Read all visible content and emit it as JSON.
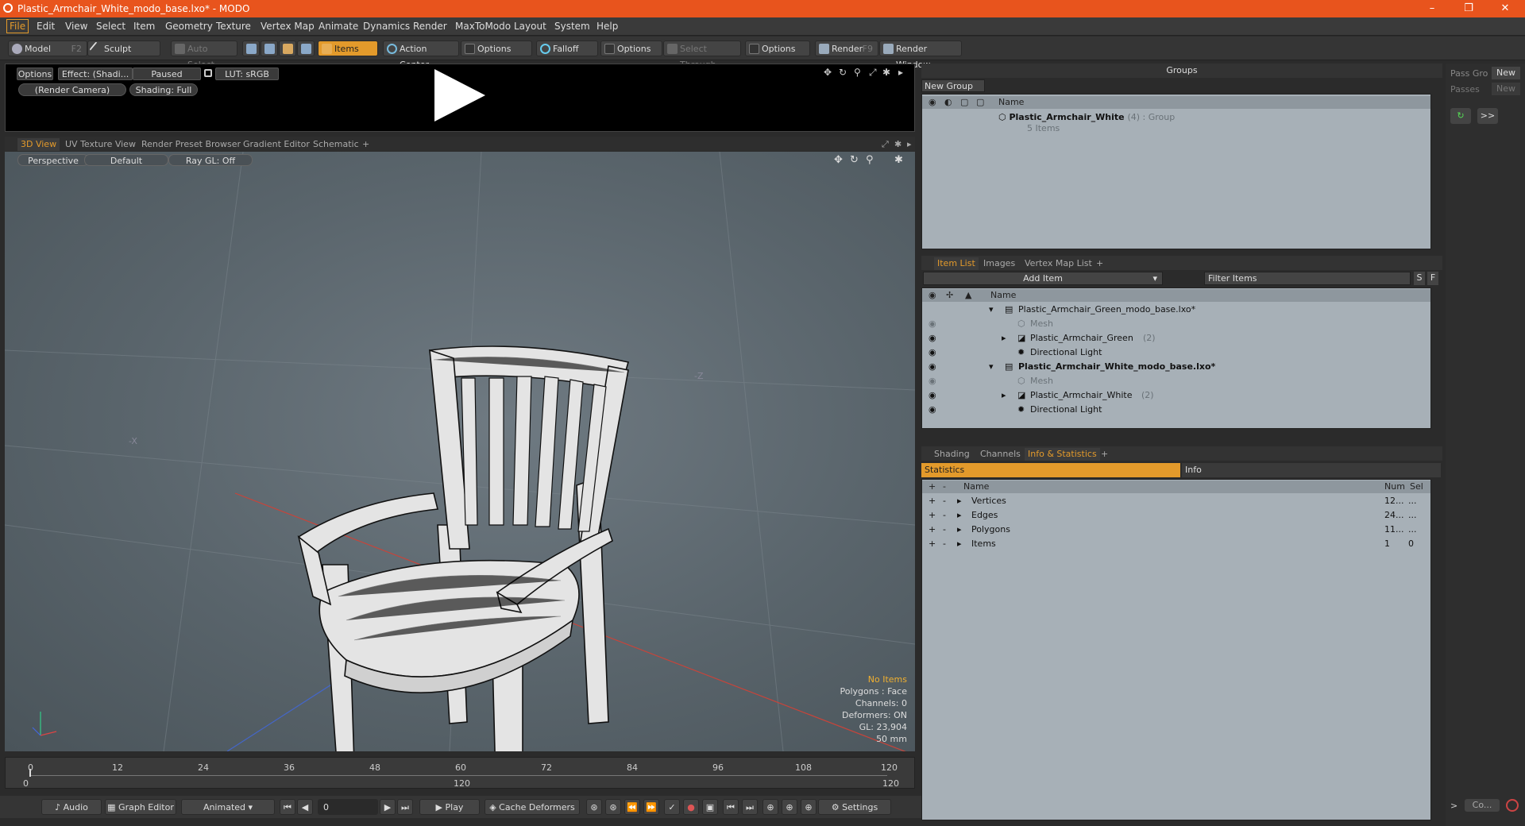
{
  "titlebar": {
    "title": "Plastic_Armchair_White_modo_base.lxo* - MODO",
    "minimize": "–",
    "restore": "❐",
    "close": "✕"
  },
  "menu": [
    "File",
    "Edit",
    "View",
    "Select",
    "Item",
    "Geometry",
    "Texture",
    "Vertex Map",
    "Animate",
    "Dynamics",
    "Render",
    "MaxToModo",
    "Layout",
    "System",
    "Help"
  ],
  "toolbar": {
    "model": "Model",
    "model_key": "F2",
    "sculpt": "Sculpt",
    "auto_select": "Auto Select",
    "items": "Items",
    "action_center": "Action Center",
    "options1": "Options",
    "falloff": "Falloff",
    "options2": "Options",
    "select_through": "Select Through",
    "options3": "Options",
    "render": "Render",
    "render_key": "F9",
    "render_window": "Render Window"
  },
  "render_panel": {
    "options": "Options",
    "effect": "Effect: (Shadi...",
    "paused": "Paused",
    "lut": "LUT: sRGB",
    "camera": "(Render Camera)",
    "shading": "Shading: Full"
  },
  "view_tabs": [
    "3D View",
    "UV Texture View",
    "Render Preset Browser",
    "Gradient Editor",
    "Schematic",
    "+"
  ],
  "viewport": {
    "perspective": "Perspective",
    "default": "Default",
    "raygl": "Ray GL: Off",
    "axis_x": "-X",
    "axis_z": "-Z"
  },
  "stats": {
    "no_items": "No Items",
    "polygons": "Polygons : Face",
    "channels": "Channels: 0",
    "deformers": "Deformers: ON",
    "gl": "GL: 23,904",
    "focal": "50 mm"
  },
  "timeline": {
    "ticks": [
      "0",
      "12",
      "24",
      "36",
      "48",
      "60",
      "72",
      "84",
      "96",
      "108",
      "120"
    ],
    "start": "0",
    "mid": "120",
    "end": "120"
  },
  "bottombar": {
    "audio": "Audio",
    "graph_editor": "Graph Editor",
    "animated": "Animated",
    "frame": "0",
    "play": "Play",
    "cache_deformers": "Cache Deformers",
    "settings": "Settings"
  },
  "groups": {
    "title": "Groups",
    "new_group": "New Group",
    "col_name": "Name",
    "group_name": "Plastic_Armchair_White",
    "group_count": "(4) : Group",
    "group_items": "5 Items"
  },
  "item_list": {
    "tabs": [
      "Item List",
      "Images",
      "Vertex Map List",
      "+"
    ],
    "add_item": "Add Item",
    "filter": "Filter Items",
    "s": "S",
    "f": "F",
    "col_name": "Name",
    "rows": [
      {
        "label": "Plastic_Armchair_Green_modo_base.lxo*",
        "extra": ""
      },
      {
        "label": "Mesh",
        "extra": ""
      },
      {
        "label": "Plastic_Armchair_Green",
        "extra": "(2)"
      },
      {
        "label": "Directional Light",
        "extra": ""
      },
      {
        "label": "Plastic_Armchair_White_modo_base.lxo*",
        "extra": ""
      },
      {
        "label": "Mesh",
        "extra": ""
      },
      {
        "label": "Plastic_Armchair_White",
        "extra": "(2)"
      },
      {
        "label": "Directional Light",
        "extra": ""
      }
    ]
  },
  "info": {
    "tabs": [
      "Shading",
      "Channels",
      "Info & Statistics",
      "+"
    ],
    "statistics": "Statistics",
    "info": "Info",
    "col_name": "Name",
    "col_num": "Num",
    "col_sel": "Sel",
    "rows": [
      {
        "name": "Vertices",
        "num": "12...",
        "sel": "..."
      },
      {
        "name": "Edges",
        "num": "24...",
        "sel": "..."
      },
      {
        "name": "Polygons",
        "num": "11...",
        "sel": "..."
      },
      {
        "name": "Items",
        "num": "1",
        "sel": "0"
      }
    ]
  },
  "far_right": {
    "pass_group": "Pass Gro",
    "new1": "New",
    "passes": "Passes",
    "new2": "New",
    "more": ">>",
    "co": "Co..."
  },
  "colors": {
    "accent": "#e39a2b",
    "titlebar": "#e8541d",
    "panel": "#a7b0b7"
  }
}
